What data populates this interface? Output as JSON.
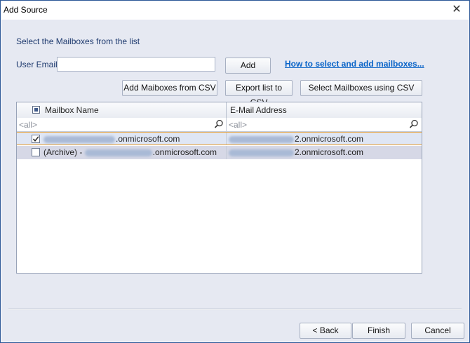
{
  "window": {
    "title": "Add Source",
    "close_glyph": "✕"
  },
  "header": {
    "subtitle": "Select the Mailboxes from the list"
  },
  "email": {
    "label": "User Email",
    "value": "",
    "placeholder": ""
  },
  "buttons": {
    "add": "Add",
    "add_from_csv": "Add Maiboxes from CSV",
    "export_csv": "Export list to CSV",
    "select_csv": "Select Mailboxes using CSV"
  },
  "help_link": "How to select and add mailboxes...",
  "grid": {
    "columns": [
      "Mailbox Name",
      "E-Mail Address"
    ],
    "filter": [
      "<all>",
      "<all>"
    ],
    "rows": [
      {
        "checked": true,
        "name_prefix": "",
        "name_suffix": ".onmicrosoft.com",
        "email_suffix": "2.onmicrosoft.com"
      },
      {
        "checked": false,
        "name_prefix": "(Archive) - ",
        "name_suffix": ".onmicrosoft.com",
        "email_suffix": "2.onmicrosoft.com"
      }
    ]
  },
  "footer": {
    "back": "< Back",
    "finish": "Finish",
    "cancel": "Cancel"
  }
}
